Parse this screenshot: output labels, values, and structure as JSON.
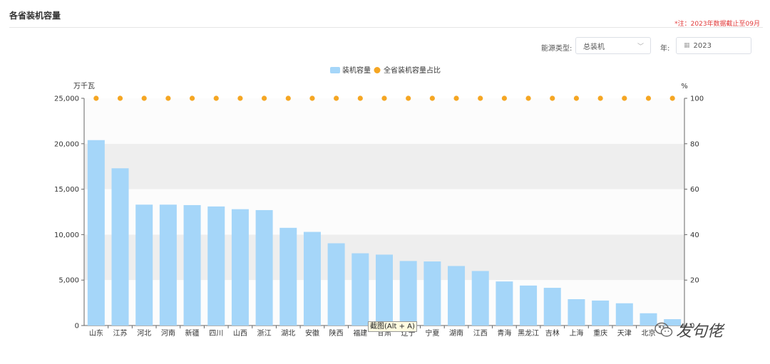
{
  "page": {
    "title": "各省装机容量",
    "note": "*注：2023年数据截止至09月"
  },
  "filters": {
    "energy_label": "能源类型:",
    "energy_value": "总装机",
    "year_label": "年:",
    "year_value": "2023"
  },
  "tooltip": "截图(Alt + A)",
  "watermark": "发句佬",
  "colors": {
    "bar": "#a5d6f9",
    "dot": "#f5a623",
    "band": "#eeeeee",
    "note": "#e23b3b"
  },
  "chart_data": {
    "type": "bar",
    "categories": [
      "山东",
      "江苏",
      "河北",
      "河南",
      "新疆",
      "四川",
      "山西",
      "浙江",
      "湖北",
      "安徽",
      "陕西",
      "福建",
      "甘肃",
      "辽宁",
      "宁夏",
      "湖南",
      "江西",
      "青海",
      "黑龙江",
      "吉林",
      "上海",
      "重庆",
      "天津",
      "北京",
      ""
    ],
    "series": [
      {
        "name": "装机容量",
        "type": "bar",
        "axis": "left",
        "values": [
          20400,
          17300,
          13300,
          13300,
          13250,
          13100,
          12800,
          12700,
          10750,
          10300,
          9050,
          7950,
          7800,
          7100,
          7050,
          6550,
          6000,
          4850,
          4400,
          4150,
          2900,
          2750,
          2450,
          1350,
          700
        ]
      },
      {
        "name": "全省装机容量占比",
        "type": "scatter",
        "axis": "right",
        "values": [
          100,
          100,
          100,
          100,
          100,
          100,
          100,
          100,
          100,
          100,
          100,
          100,
          100,
          100,
          100,
          100,
          100,
          100,
          100,
          100,
          100,
          100,
          100,
          100,
          100
        ]
      }
    ],
    "y_left": {
      "unit": "万千瓦",
      "ticks": [
        "0",
        "5,000",
        "10,000",
        "15,000",
        "20,000",
        "25,000"
      ],
      "range": [
        0,
        25000
      ]
    },
    "y_right": {
      "unit": "%",
      "ticks": [
        "0",
        "20",
        "40",
        "60",
        "80",
        "100"
      ],
      "range": [
        0,
        100
      ]
    },
    "legend_position": "top-center",
    "grid": "alternating-bands"
  }
}
